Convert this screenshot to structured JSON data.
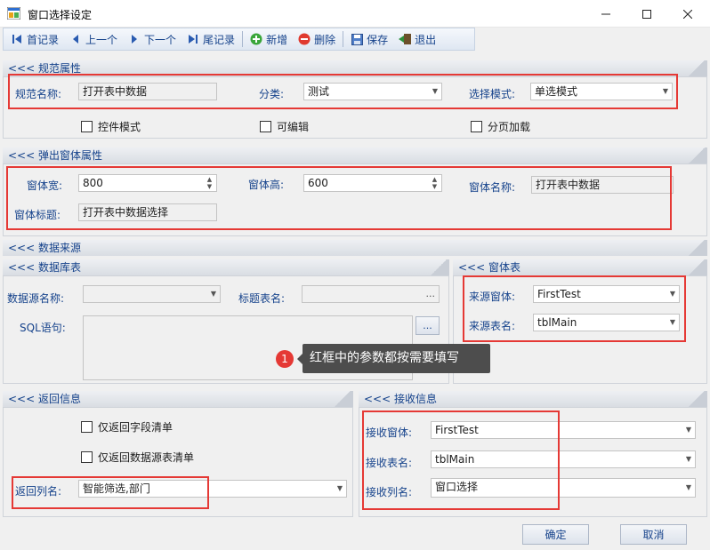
{
  "window": {
    "title": "窗口选择设定"
  },
  "toolbar": {
    "first": "首记录",
    "prev": "上一个",
    "next": "下一个",
    "last": "尾记录",
    "add": "新增",
    "delete": "删除",
    "save": "保存",
    "exit": "退出"
  },
  "spec": {
    "header": "<<< 规范属性",
    "name_label": "规范名称:",
    "name_value": "打开表中数据",
    "category_label": "分类:",
    "category_value": "测试",
    "mode_label": "选择模式:",
    "mode_value": "单选模式",
    "control_mode": "控件模式",
    "editable": "可编辑",
    "paging": "分页加载"
  },
  "popup": {
    "header": "<<< 弹出窗体属性",
    "width_label": "窗体宽:",
    "width_value": "800",
    "height_label": "窗体高:",
    "height_value": "600",
    "form_name_label": "窗体名称:",
    "form_name_value": "打开表中数据",
    "form_title_label": "窗体标题:",
    "form_title_value": "打开表中数据选择"
  },
  "datasource": {
    "header": "<<< 数据来源",
    "db_header": "<<< 数据库表",
    "ds_name_label": "数据源名称:",
    "ds_name_value": "",
    "title_table_label": "标题表名:",
    "title_table_value": "",
    "ellipsis": "...",
    "sql_label": "SQL语句:",
    "sql_value": "",
    "form_header": "<<< 窗体表",
    "source_form_label": "来源窗体:",
    "source_form_value": "FirstTest",
    "source_table_label": "来源表名:",
    "source_table_value": "tblMain"
  },
  "return_info": {
    "header": "<<< 返回信息",
    "only_fields": "仅返回字段清单",
    "only_ds_tables": "仅返回数据源表清单",
    "columns_label": "返回列名:",
    "columns_value": "智能筛选,部门"
  },
  "receive_info": {
    "header": "<<< 接收信息",
    "form_label": "接收窗体:",
    "form_value": "FirstTest",
    "table_label": "接收表名:",
    "table_value": "tblMain",
    "column_label": "接收列名:",
    "column_value": "窗口选择"
  },
  "callout": {
    "number": "1",
    "text": "红框中的参数都按需要填写"
  },
  "footer": {
    "ok": "确定",
    "cancel": "取消"
  },
  "colors": {
    "accent": "#15428b",
    "highlight": "#e53935",
    "callout_bg": "#4d4d4d"
  }
}
